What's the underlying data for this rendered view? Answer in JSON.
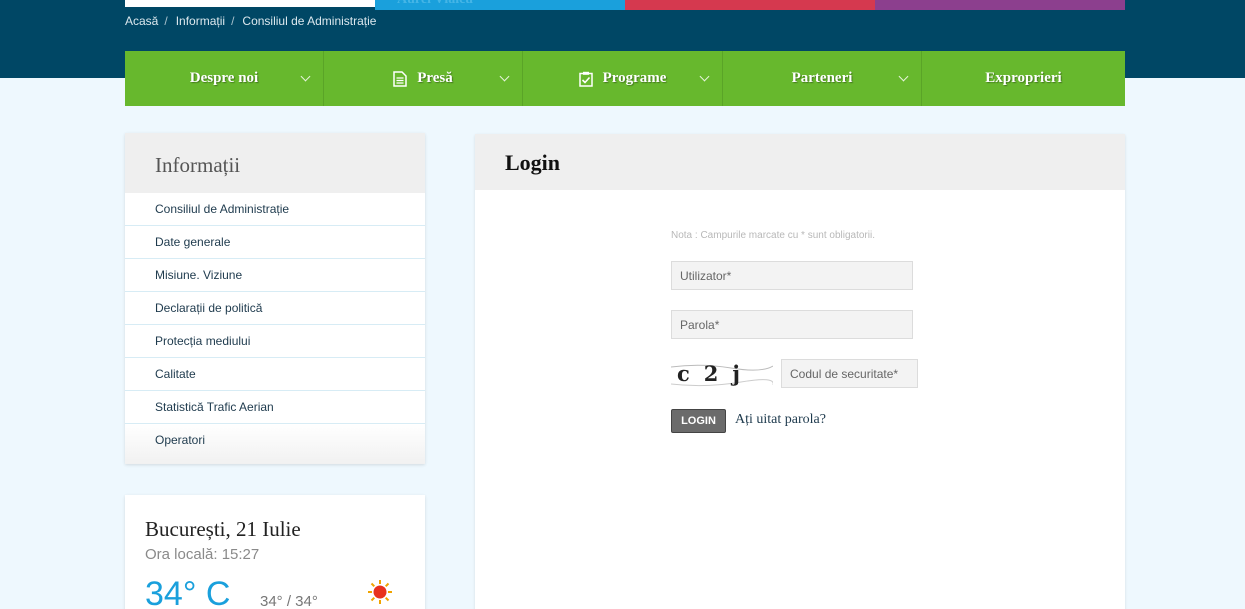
{
  "header": {
    "partial_banner_text": "Aurel Vlaicu",
    "breadcrumb": [
      "Acasă",
      "Informații",
      "Consiliul de Administrație"
    ]
  },
  "nav": {
    "items": [
      {
        "label": "Despre noi",
        "icon": "",
        "dropdown": true
      },
      {
        "label": "Presă",
        "icon": "document-icon",
        "dropdown": true
      },
      {
        "label": "Programe",
        "icon": "clipboard-check-icon",
        "dropdown": true
      },
      {
        "label": "Parteneri",
        "icon": "",
        "dropdown": true
      },
      {
        "label": "Exproprieri",
        "icon": "",
        "dropdown": false
      }
    ]
  },
  "sidebar": {
    "title": "Informații",
    "items": [
      "Consiliul de Administrație",
      "Date generale",
      "Misiune. Viziune",
      "Declarații de politică",
      "Protecția mediului",
      "Calitate",
      "Statistică Trafic Aerian",
      "Operatori"
    ]
  },
  "weather": {
    "city_date": "București, 21 Iulie",
    "local_time": "Ora locală: 15:27",
    "temperature": "34° C",
    "range": "34° / 34°",
    "icon": "sun-icon"
  },
  "login": {
    "title": "Login",
    "note": "Nota : Campurile marcate cu * sunt obligatorii.",
    "username_placeholder": "Utilizator*",
    "password_placeholder": "Parola*",
    "captcha_placeholder": "Codul de securitate*",
    "captcha_text": "c2j",
    "button_label": "LOGIN",
    "forgot_label": "Ați uitat parola?"
  },
  "colors": {
    "header_bg": "#004765",
    "nav_green": "#67b82d",
    "accent_blue": "#1aa0dc"
  }
}
